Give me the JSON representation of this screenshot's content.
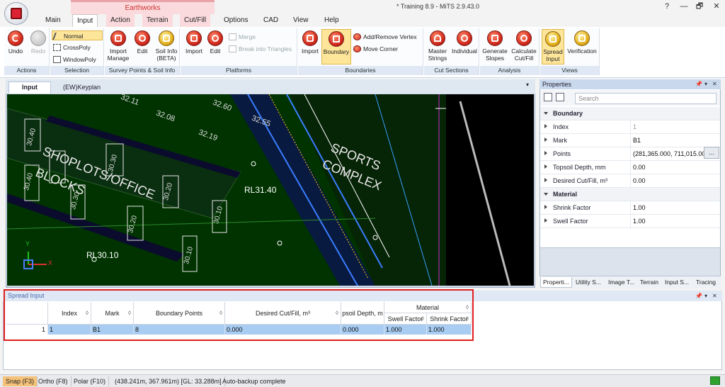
{
  "window": {
    "title": "* Training 8.9 - MiTS 2.9.43.0",
    "context_tab": "Earthworks",
    "help": "?",
    "minimize": "—",
    "restore": "🗗",
    "close": "✕"
  },
  "menu_tabs": [
    "Main",
    "Input",
    "Action",
    "Terrain",
    "Cut/Fill",
    "Options",
    "CAD",
    "View",
    "Help"
  ],
  "ribbon": {
    "actions": {
      "label": "Actions",
      "undo": "Undo",
      "redo": "Redo"
    },
    "selection": {
      "label": "Selection",
      "normal": "Normal",
      "crosspoly": "CrossPoly",
      "windowpoly": "WindowPoly"
    },
    "survey": {
      "label": "Survey Points & Soil Info",
      "import_manage": "Import Manage",
      "edit": "Edit",
      "soil_info": "Soil Info (BETA)"
    },
    "platforms": {
      "label": "Platforms",
      "import": "Import",
      "edit": "Edit",
      "merge": "Merge",
      "break": "Break into Triangles"
    },
    "boundaries": {
      "label": "Boundaries",
      "import": "Import",
      "boundary": "Boundary",
      "add_remove": "Add/Remove Vertex",
      "move_corner": "Move Corner"
    },
    "cut_sections": {
      "label": "Cut Sections",
      "master": "Master Strings",
      "individual": "Individual"
    },
    "analysis": {
      "label": "Analysis",
      "generate": "Generate Slopes",
      "calculate": "Calculate Cut/Fill"
    },
    "views": {
      "label": "Views",
      "spread": "Spread Input",
      "verification": "Verification"
    }
  },
  "doc_tabs": [
    "Input",
    "(EW)Keyplan"
  ],
  "doc_menu": "▾",
  "cad": {
    "labels": [
      "SHOPLOTS/OFFICE",
      "BLOCKS",
      "SPORTS",
      "COMPLEX",
      "RL31.40",
      "RL30.10"
    ],
    "levels": [
      "32.11",
      "32.08",
      "32.19",
      "32.60",
      "32.55",
      "30.40",
      "30.30",
      "30.40",
      "30.30",
      "30.20",
      "30.20",
      "30.10",
      "30.10"
    ],
    "axis_y": "Y",
    "axis_x": "X"
  },
  "properties": {
    "title": "Properties",
    "pin": "📌",
    "menu": "▾",
    "close": "✕",
    "search_placeholder": "Search",
    "rows": [
      {
        "kind": "cat",
        "name": "Boundary",
        "value": ""
      },
      {
        "kind": "prop",
        "name": "Index",
        "value": "1"
      },
      {
        "kind": "prop",
        "name": "Mark",
        "value": "B1"
      },
      {
        "kind": "prop",
        "name": "Points",
        "value": "(281,365.000, 711,015.000"
      },
      {
        "kind": "prop",
        "name": "Topsoil Depth, mm",
        "value": "0.00"
      },
      {
        "kind": "prop",
        "name": "Desired Cut/Fill, m³",
        "value": "0.00"
      },
      {
        "kind": "cat",
        "name": "Material",
        "value": ""
      },
      {
        "kind": "prop",
        "name": "Shrink Factor",
        "value": "1.00"
      },
      {
        "kind": "prop",
        "name": "Swell Factor",
        "value": "1.00"
      }
    ],
    "ellipsis": "...",
    "bottom_tabs": [
      "Properti...",
      "Utility S...",
      "Image T...",
      "Terrain",
      "Input S...",
      "Tracing"
    ]
  },
  "spread": {
    "title": "Spread Input",
    "headers": {
      "index": "Index",
      "mark": "Mark",
      "boundary_points": "Boundary Points",
      "desired_cut_fill": "Desired Cut/Fill, m³",
      "topsoil_depth": "psoil Depth, m",
      "material": "Material",
      "swell": "Swell Factor",
      "shrink": "Shrink Factor"
    },
    "sort_glyph": "◊",
    "row": {
      "num": "1",
      "index": "1",
      "mark": "B1",
      "boundary_points": "8",
      "desired_cut_fill": "0.000",
      "topsoil_depth": "0.000",
      "swell": "1.000",
      "shrink": "1.000"
    }
  },
  "status": {
    "snap": "Snap (F3)",
    "ortho": "Ortho (F8)",
    "polar": "Polar (F10)",
    "coords": "(438.241m, 367.961m) [GL: 33.288m]",
    "message": "Auto-backup complete"
  },
  "colors": {
    "accent": "#fde59a",
    "context": "#fadadc",
    "selection": "#a9cdf2",
    "alert": "#e02020"
  }
}
